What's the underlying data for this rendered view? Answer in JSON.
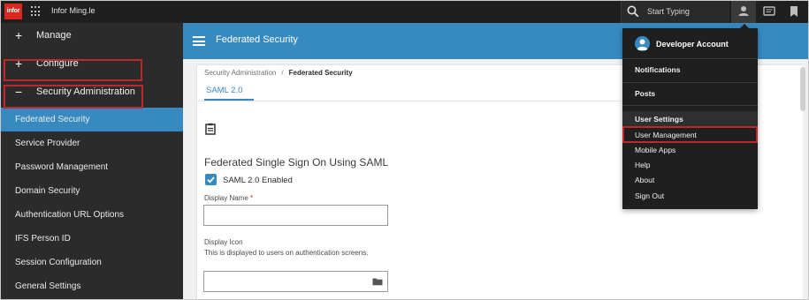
{
  "topbar": {
    "logo_text": "infor",
    "app_name": "Infor Ming.le",
    "search_placeholder": "Start Typing",
    "icons": [
      "app-grid-icon",
      "search-icon",
      "user-icon",
      "chat-icon",
      "bookmark-icon"
    ]
  },
  "sidebar": {
    "groups": [
      {
        "sign": "+",
        "label": "Manage"
      },
      {
        "sign": "+",
        "label": "Configure"
      },
      {
        "sign": "−",
        "label": "Security Administration"
      }
    ],
    "items": [
      {
        "label": "Federated Security"
      },
      {
        "label": "Service Provider"
      },
      {
        "label": "Password Management"
      },
      {
        "label": "Domain Security"
      },
      {
        "label": "Authentication URL Options"
      },
      {
        "label": "IFS Person ID"
      },
      {
        "label": "Session Configuration"
      },
      {
        "label": "General Settings"
      }
    ]
  },
  "main": {
    "header_title": "Federated Security",
    "breadcrumb": {
      "root": "Security Administration",
      "separator": "/",
      "current": "Federated Security"
    },
    "tab": "SAML 2.0",
    "section_title": "Federated Single Sign On Using SAML",
    "checkbox_label": "SAML 2.0 Enabled",
    "display_name_label": "Display Name",
    "required_mark": "*",
    "display_icon_label": "Display Icon",
    "display_icon_help": "This is displayed to users on authentication screens."
  },
  "menu": {
    "account_name": "Developer Account",
    "items": [
      {
        "label": "Notifications"
      },
      {
        "label": "Posts"
      },
      {
        "label": "User Settings"
      },
      {
        "label": "User Management"
      },
      {
        "label": "Mobile Apps"
      },
      {
        "label": "Help"
      },
      {
        "label": "About"
      },
      {
        "label": "Sign Out"
      }
    ]
  },
  "colors": {
    "accent": "#368ac0",
    "highlight_outline": "#c0272d",
    "topbar": "#1f1f1f",
    "sidebar": "#2b2b2b"
  }
}
